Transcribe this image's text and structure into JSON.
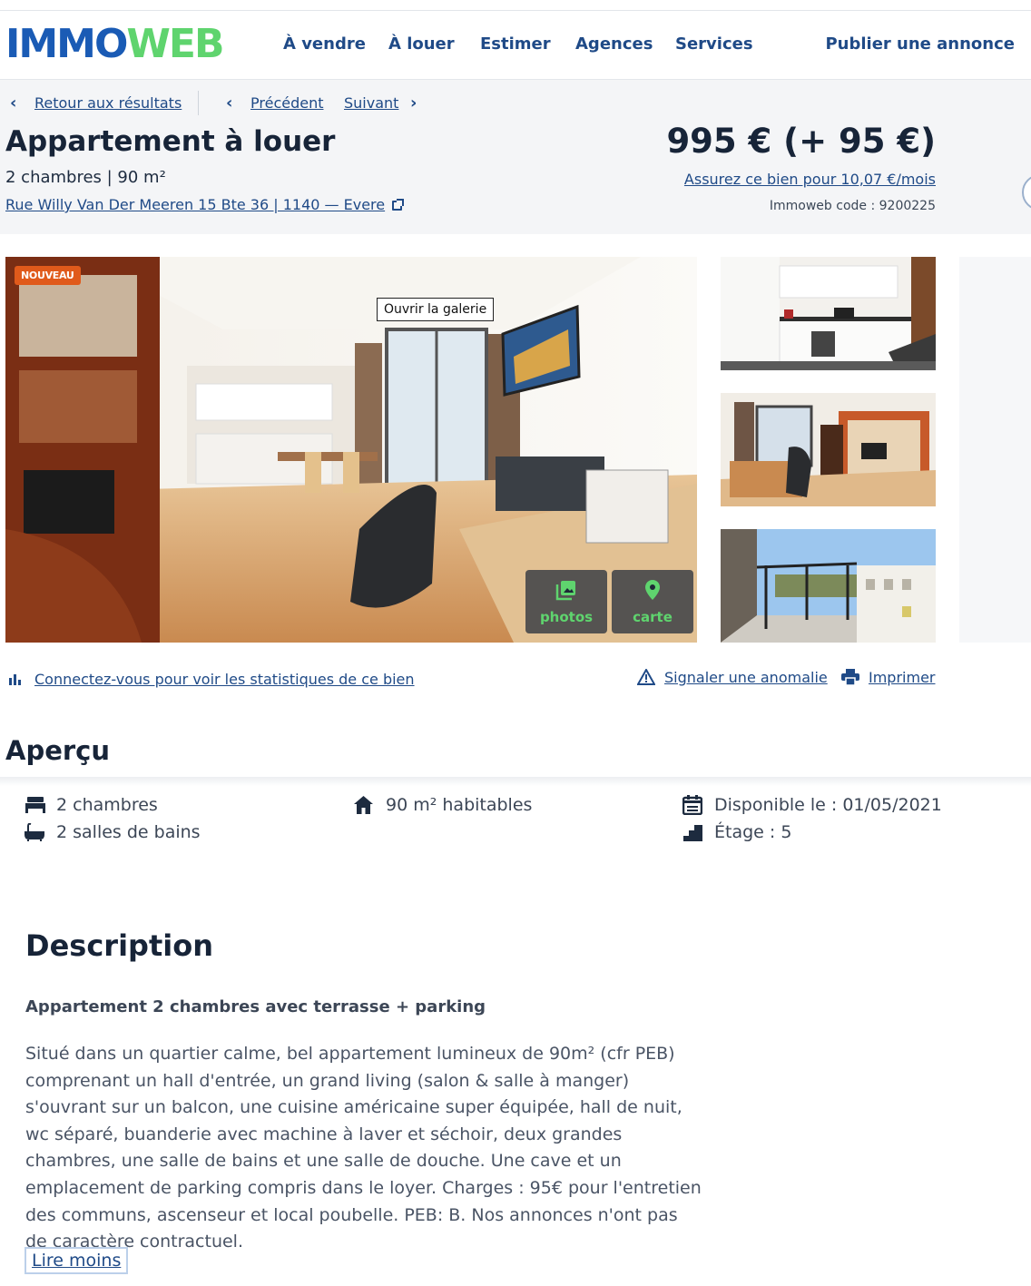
{
  "header": {
    "logo_left": "IMMO",
    "logo_right": "WEB",
    "nav": [
      "À vendre",
      "À louer",
      "Estimer",
      "Agences",
      "Services"
    ],
    "publish": "Publier une annonce"
  },
  "breadcrumb": {
    "back": "Retour aux résultats",
    "prev": "Précédent",
    "next": "Suivant"
  },
  "listing": {
    "title": "Appartement à louer",
    "subtitle": "2 chambres | 90 m²",
    "address": "Rue Willy Van Der Meeren 15 Bte 36 | 1140 — Evere",
    "price": "995 € (+ 95 €)",
    "insure": "Assurez ce bien pour 10,07 €/mois",
    "code": "Immoweb code : 9200225"
  },
  "gallery": {
    "badge": "NOUVEAU",
    "open": "Ouvrir la galerie",
    "photos_label": "photos",
    "map_label": "carte"
  },
  "actions": {
    "stats": "Connectez-vous pour voir les statistiques de ce bien",
    "report": "Signaler une anomalie",
    "print": "Imprimer"
  },
  "overview": {
    "title": "Aperçu",
    "bedrooms": "2 chambres",
    "bathrooms": "2 salles de bains",
    "surface": "90 m² habitables",
    "available": "Disponible le : 01/05/2021",
    "floor": "Étage : 5"
  },
  "description": {
    "title": "Description",
    "subtitle": "Appartement 2 chambres avec terrasse + parking",
    "body": "Situé dans un quartier calme, bel appartement lumineux de 90m² (cfr PEB) comprenant un hall d'entrée, un grand living (salon & salle à manger) s'ouvrant sur un balcon, une cuisine américaine super équipée, hall de nuit, wc séparé, buanderie avec machine à laver et séchoir, deux grandes chambres, une salle de bains et une salle de douche. Une cave et un emplacement de parking compris dans le loyer. Charges : 95€ pour l'entretien des communs, ascenseur et local poubelle. PEB: B. Nos annonces n'ont pas de caractère contractuel.",
    "read_less": "Lire moins"
  },
  "colors": {
    "brand_blue": "#1a5bb5",
    "brand_green": "#5fd46e",
    "link": "#1f4a87",
    "badge": "#e05a1b"
  }
}
